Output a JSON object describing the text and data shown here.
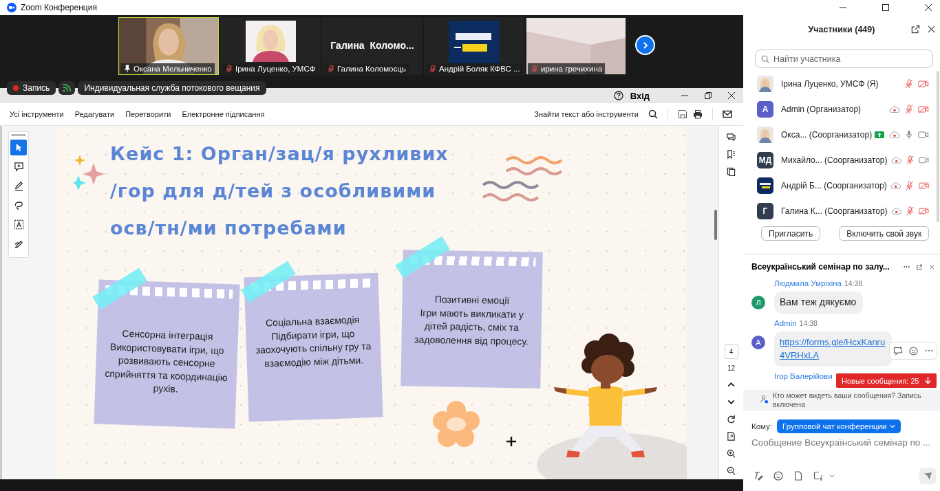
{
  "window": {
    "title": "Zoom Конференция"
  },
  "video_strip": {
    "tiles": [
      {
        "name": "Оксана Мельниченко",
        "kind": "video",
        "pinned": true,
        "muted": false,
        "active_speaker": true
      },
      {
        "name": "Ірина Луценко, УМСФ",
        "pinned": false,
        "muted": true,
        "active_speaker": false
      },
      {
        "name": "Галина Коломоєць",
        "kind": "name",
        "display_name": "Галина  Коломо...",
        "pinned": false,
        "muted": true,
        "active_speaker": false
      },
      {
        "name": "Андрій Боляк КФВС ...",
        "kind": "logo",
        "pinned": false,
        "muted": true,
        "active_speaker": false
      },
      {
        "name": "ирина гречихина",
        "kind": "video",
        "pinned": false,
        "muted": true,
        "active_speaker": false
      }
    ]
  },
  "recording": {
    "label": "Запись"
  },
  "streaming": {
    "label": "Индивидуальная служба потокового вещания"
  },
  "reader": {
    "sign_in": "Вхід",
    "menu": [
      "Усі інструменти",
      "Редагувати",
      "Перетворити",
      "Електронне підписання"
    ],
    "search_label": "Знайти текст або інструменти",
    "tools": [
      {
        "kind": "select",
        "selected": true
      },
      {
        "kind": "comment",
        "selected": false
      },
      {
        "kind": "draw",
        "selected": false
      },
      {
        "kind": "lasso",
        "selected": false
      },
      {
        "kind": "text",
        "selected": false
      },
      {
        "kind": "sign",
        "selected": false
      }
    ],
    "page_current": "4",
    "page_total": "12"
  },
  "slide": {
    "title_lines": [
      "Кейс 1: Орган/зац/я рухливих",
      "/гор для д/тей з особливими",
      "осв/тн/ми потребами"
    ],
    "notes": [
      {
        "heading": "Сенсорна інтеграція",
        "text": "Використовувати ігри, що розвивають сенсорне сприйняття та координацію рухів."
      },
      {
        "heading": "Соціальна взаємодія",
        "text": "Підбирати ігри, що заохочують спільну гру та взаємодію між дітьми."
      },
      {
        "heading": "Позитивні емоції",
        "text": "Ігри мають викликати у дітей радість, сміх та задоволення від процесу."
      }
    ]
  },
  "participants": {
    "title": "Участники (449)",
    "search_placeholder": "Найти участника",
    "items": [
      {
        "name": "Ірина Луценко, УМСФ (Я)",
        "sharing": false,
        "recording": false,
        "muted": true,
        "video_on": false
      },
      {
        "name": "Admin (Организатор)",
        "avatar": {
          "kind": "letter",
          "text": "A",
          "color": "#5b5fc7"
        },
        "sharing": false,
        "recording": true,
        "muted": true,
        "video_on": false
      },
      {
        "name": "Окса... (Соорганизатор)",
        "sharing": true,
        "recording": true,
        "muted": false,
        "video_on": true
      },
      {
        "name": "Михайло... (Соорганизатор)",
        "avatar": {
          "kind": "letter",
          "text": "МД",
          "color": "#2f3d4f"
        },
        "sharing": false,
        "recording": true,
        "muted": true,
        "video_on": true
      },
      {
        "name": "Андрій Б... (Соорганизатор)",
        "avatar": {
          "kind": "logo"
        },
        "sharing": false,
        "recording": true,
        "muted": true,
        "video_on": false
      },
      {
        "name": "Галина К... (Соорганизатор)",
        "avatar": {
          "kind": "letter",
          "text": "Г",
          "color": "#2f3d4f"
        },
        "sharing": false,
        "recording": true,
        "muted": true,
        "video_on": false
      }
    ],
    "buttons": [
      "Пригласить",
      "Включить свой звук"
    ]
  },
  "chat": {
    "title": "Всеукраїнський семінар по залу...",
    "messages": [
      {
        "kind": "text",
        "sender": "Людмила Умріхіна",
        "time": "14:38",
        "avatar": "Л",
        "color": "#1d9a6c",
        "lines": [
          "Вам теж дякуємо"
        ]
      },
      {
        "kind": "link",
        "sender": "Admin",
        "time": "14:38",
        "avatar": "A",
        "color": "#5b5fc7",
        "lines": [
          "https://forms.gle/HcxKanru",
          "4VRHxLA"
        ]
      },
      {
        "kind": "partial",
        "sender": "Ігор Валерійови"
      }
    ],
    "new_messages": "Новые сообщения: 25",
    "notice": "Кто может видеть ваши сообщения? Запись включена",
    "to_label": "Кому:",
    "recipient": "Групповой чат конференции",
    "input_placeholder": "Сообщение Всеукраїнський семінар по ..."
  }
}
